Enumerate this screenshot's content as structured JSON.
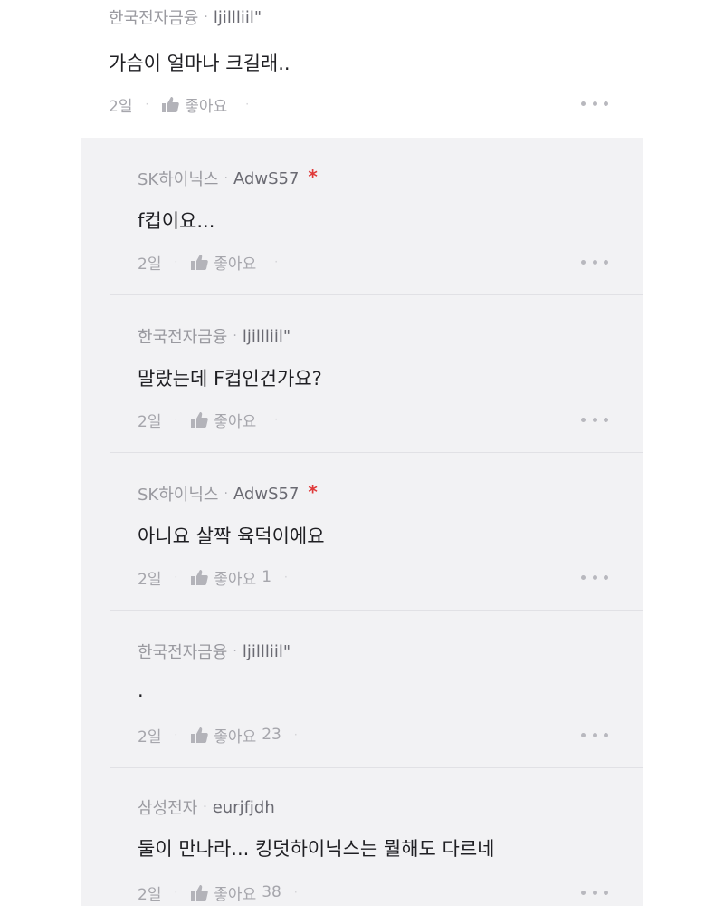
{
  "top_comment": {
    "company": "한국전자금융",
    "nickname": "ljillliil\"",
    "text": "가슴이 얼마나 크길래..",
    "time": "2일",
    "like_label": "좋아요",
    "like_count": ""
  },
  "replies": [
    {
      "company": "SK하이닉스",
      "nickname": "AdwS57",
      "op_mark": "*",
      "text": "f컵이요...",
      "time": "2일",
      "like_label": "좋아요",
      "like_count": ""
    },
    {
      "company": "한국전자금융",
      "nickname": "ljillliil\"",
      "op_mark": "",
      "text": "말랐는데 F컵인건가요?",
      "time": "2일",
      "like_label": "좋아요",
      "like_count": ""
    },
    {
      "company": "SK하이닉스",
      "nickname": "AdwS57",
      "op_mark": "*",
      "text": "아니요 살짝 육덕이에요",
      "time": "2일",
      "like_label": "좋아요",
      "like_count": "1"
    },
    {
      "company": "한국전자금융",
      "nickname": "ljillliil\"",
      "op_mark": "",
      "text": ".",
      "time": "2일",
      "like_label": "좋아요",
      "like_count": "23"
    },
    {
      "company": "삼성전자",
      "nickname": "eurjfjdh",
      "op_mark": "",
      "text": "둘이 만나라... 킹덧하이닉스는 뭘해도 다르네",
      "time": "2일",
      "like_label": "좋아요",
      "like_count": "38"
    }
  ],
  "colors": {
    "panel_bg": "#f2f2f4",
    "op_mark": "#e03a3a",
    "text": "#1f1f23",
    "meta": "#8c8c92"
  },
  "icons": {
    "like": "thumbs-up-icon",
    "more": "more-dots-icon"
  }
}
